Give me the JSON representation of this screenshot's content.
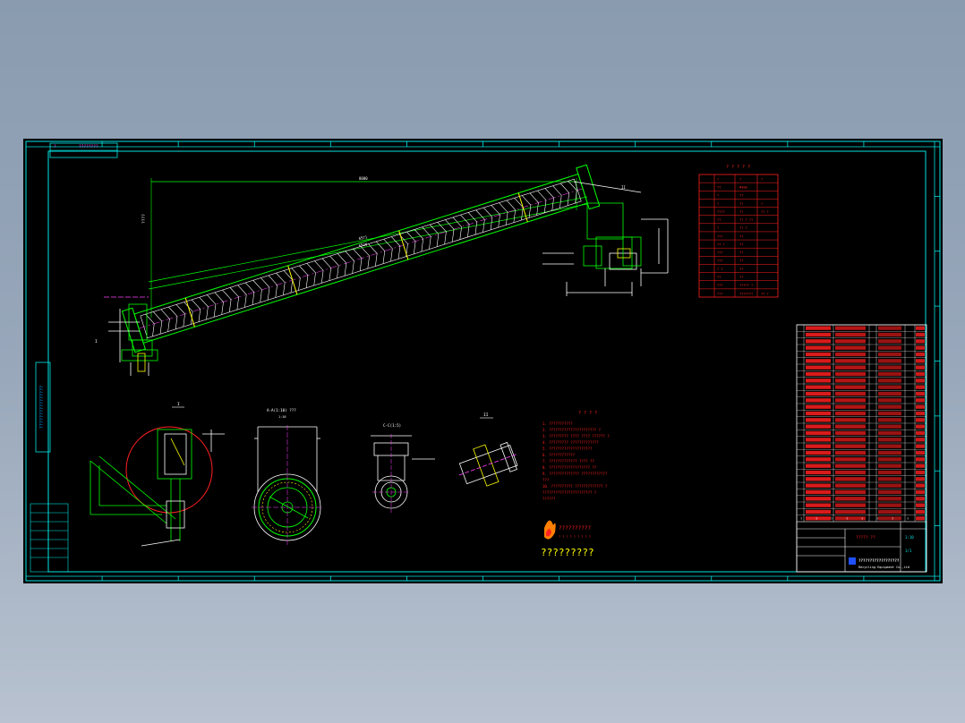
{
  "window": {
    "background": "#8f9fb4",
    "canvas_background": "#000000"
  },
  "colors": {
    "frame": "#00e5e5",
    "part": "#00ff00",
    "dim": "#ffffff",
    "red": "#ff2020",
    "magenta": "#ff40ff",
    "yellow": "#ffff00"
  },
  "title_strip": {
    "marker": "?",
    "label": "????????"
  },
  "main_view": {
    "overall_dim": "8000",
    "slope_dim_1": "6571",
    "slope_dim_2": "6520",
    "vertical_label": "????",
    "inclined_label": "17.5°"
  },
  "section_views": {
    "detail_1_label": "I",
    "section_2_label": "A-A(1:10) ???",
    "section_3_label": "C-C(1:5)",
    "section_4_label": "II",
    "scale_sub": "1:10"
  },
  "params_table": {
    "title": "? ? ? ? ?",
    "rows": [
      [
        "?",
        "?",
        "?"
      ],
      [
        "??",
        "Φ300",
        ""
      ],
      [
        "?",
        "??",
        ""
      ],
      [
        "?",
        "??",
        "?"
      ],
      [
        "????",
        "??",
        "?? ?"
      ],
      [
        "??",
        "?? ? ??",
        ""
      ],
      [
        "?",
        "?? ?",
        ""
      ],
      [
        "???",
        "??",
        ""
      ],
      [
        "?? ?",
        "??",
        ""
      ],
      [
        "???",
        "??",
        ""
      ],
      [
        "???",
        "??",
        ""
      ],
      [
        "? ?",
        "??",
        ""
      ],
      [
        "??",
        "??",
        ""
      ],
      [
        "???",
        "????? ?",
        ""
      ],
      [
        "???",
        "???????",
        "?? ?"
      ]
    ]
  },
  "tech_notes": {
    "title": "? ? ? ?",
    "lines": [
      "1. ???????????",
      "2. ?????????????????????? ?",
      "3. ????????? ???? ???? ?????? ?",
      "4. ????????? ?????????????",
      "5. ????????????????????",
      "6. ????????????",
      "7. ????????????? ???? ??",
      "8. ??????????????????? ??",
      "9. ?????????????? ????????????",
      "   ???",
      "10. ?????????? ????????????? ?",
      "   ??????????????????????? ?",
      "   ??????"
    ]
  },
  "logo": {
    "line1": "??????????",
    "line2": "? ? ? ? ? ? ? ? ?",
    "bottom": "?????????"
  },
  "bom": {
    "rows": 30,
    "header": [
      "?",
      "?",
      "?",
      "?",
      "?",
      "?",
      "?",
      "?"
    ],
    "title_block": {
      "company": "??????????????????",
      "company_en": "Recycling Equipment Co.,Ltd",
      "drawing_name": "????? ??",
      "scale": "1:10",
      "sheet": "1/1"
    }
  },
  "left_block": {
    "vertical_text": "????????????????"
  }
}
